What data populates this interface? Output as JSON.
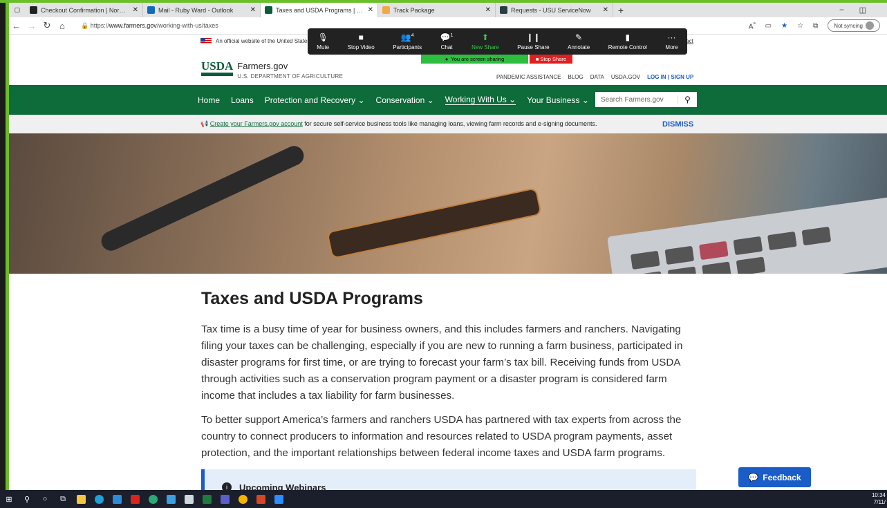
{
  "browser": {
    "tabs": [
      {
        "label": "Checkout Confirmation | Nordstr",
        "icon": "nordstrom-icon",
        "color": "#222222",
        "active": false
      },
      {
        "label": "Mail - Ruby Ward - Outlook",
        "icon": "outlook-icon",
        "color": "#0f6cbd",
        "active": false
      },
      {
        "label": "Taxes and USDA Programs | Farm",
        "icon": "usda-icon",
        "color": "#0a5c3a",
        "active": true
      },
      {
        "label": "Track Package",
        "icon": "amazon-icon",
        "color": "#f3a847",
        "active": false
      },
      {
        "label": "Requests - USU ServiceNow",
        "icon": "servicenow-icon",
        "color": "#293e40",
        "active": false
      }
    ],
    "url_prefix": "https://",
    "url_host": "www.farmers.gov",
    "url_path": "/working-with-us/taxes",
    "sync_label": "Not syncing"
  },
  "zoom": {
    "items": [
      {
        "label": "Mute",
        "icon": "microphone-icon",
        "glyph": "🎙"
      },
      {
        "label": "Stop Video",
        "icon": "video-camera-icon",
        "glyph": "■"
      },
      {
        "label": "Participants",
        "icon": "participants-icon",
        "glyph": "👥",
        "badge": "4"
      },
      {
        "label": "Chat",
        "icon": "chat-icon",
        "glyph": "💬",
        "badge": "1"
      },
      {
        "label": "New Share",
        "icon": "share-screen-icon",
        "glyph": "⬆"
      },
      {
        "label": "Pause Share",
        "icon": "pause-icon",
        "glyph": "❙❙"
      },
      {
        "label": "Annotate",
        "icon": "pen-icon",
        "glyph": "✎"
      },
      {
        "label": "Remote Control",
        "icon": "mouse-icon",
        "glyph": "▮"
      },
      {
        "label": "More",
        "icon": "more-icon",
        "glyph": "···"
      }
    ],
    "sharing_text": "You are screen sharing",
    "stop_share": "Stop Share"
  },
  "site": {
    "official_banner": "An official website of the United States",
    "contact_label": "tact",
    "logo_mark": "USDA",
    "brand_name": "Farmers.gov",
    "brand_sub": "U.S. DEPARTMENT OF AGRICULTURE",
    "utility_links": [
      "PANDEMIC ASSISTANCE",
      "BLOG",
      "DATA",
      "USDA.GOV"
    ],
    "login_label": "LOG IN | SIGN UP",
    "nav": [
      {
        "label": "Home",
        "dropdown": false
      },
      {
        "label": "Loans",
        "dropdown": false
      },
      {
        "label": "Protection and Recovery",
        "dropdown": true
      },
      {
        "label": "Conservation",
        "dropdown": true
      },
      {
        "label": "Working With Us",
        "dropdown": true
      },
      {
        "label": "Your Business",
        "dropdown": true
      }
    ],
    "search_placeholder": "Search Farmers.gov",
    "notice_link": "Create your Farmers.gov account",
    "notice_text": " for secure self-service business tools like managing loans, viewing farm records and e-signing documents.",
    "dismiss_label": "DISMISS"
  },
  "content": {
    "title": "Taxes and USDA Programs",
    "p1_lines": [
      "Tax time is a busy time of year for business owners, and this includes farmers and ranchers. Navigating",
      "filing your taxes can be challenging, especially if you are new to running a farm business, participated in",
      "disaster programs for first time, or are trying to forecast your farm’s tax bill. Receiving funds from USDA",
      "through activities such as a conservation program payment or a disaster program is considered farm",
      "income that includes a tax liability for farm businesses."
    ],
    "p2_lines": [
      "To better support America’s farmers and ranchers USDA has partnered with tax experts from across the",
      "country to connect producers to information and resources related to USDA program payments, asset",
      "protection, and the important relationships between federal income taxes and USDA farm programs."
    ],
    "callout_title": "Upcoming Webinars",
    "feedback_label": "Feedback"
  },
  "taskbar": {
    "time": "10:34",
    "date": "7/11/"
  }
}
